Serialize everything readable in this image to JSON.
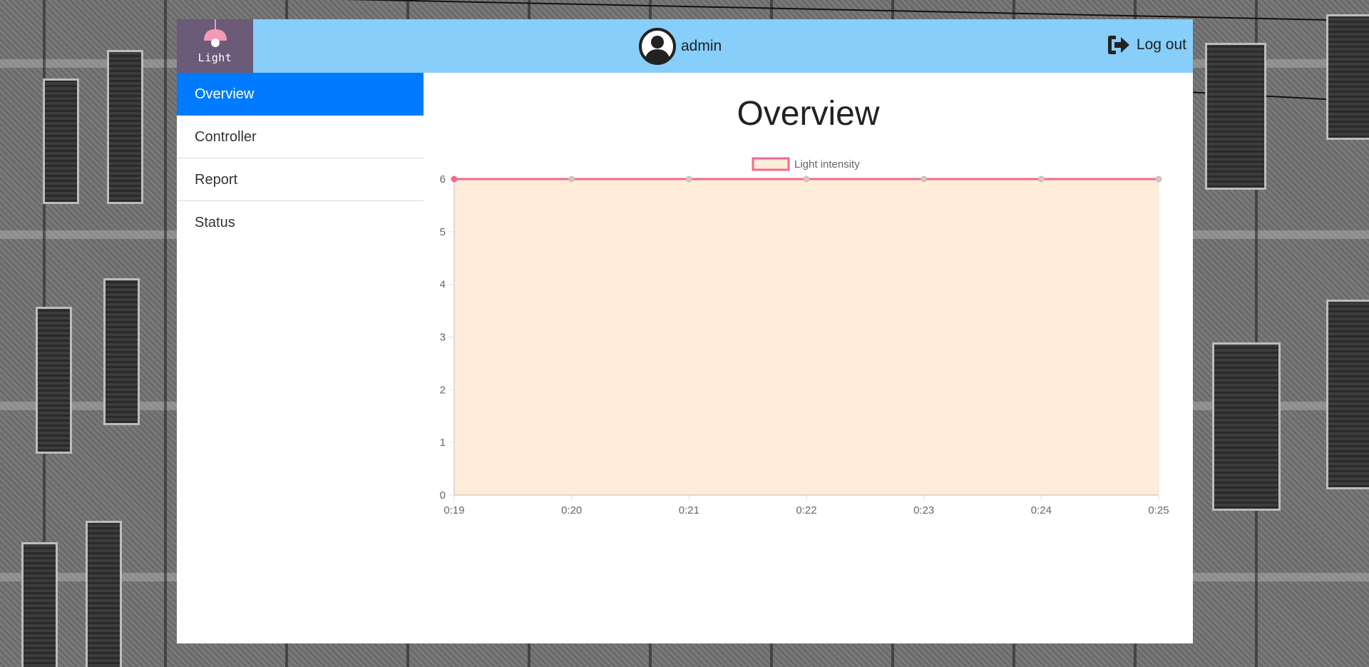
{
  "brand": {
    "label": "Light",
    "lamp_color": "#f39bb5",
    "background": "#6b5a78"
  },
  "header": {
    "background": "#87cefa",
    "user_icon": "user-circle-icon",
    "username": "admin",
    "logout_icon": "sign-out-icon",
    "logout_label": "Log out"
  },
  "sidebar": {
    "accent": "#007bff",
    "items": [
      {
        "label": "Overview",
        "active": true
      },
      {
        "label": "Controller",
        "active": false
      },
      {
        "label": "Report",
        "active": false
      },
      {
        "label": "Status",
        "active": false
      }
    ]
  },
  "main": {
    "title": "Overview"
  },
  "chart_data": {
    "type": "area",
    "x": [
      "0:19",
      "0:20",
      "0:21",
      "0:22",
      "0:23",
      "0:24",
      "0:25"
    ],
    "series": [
      {
        "name": "Light intensity",
        "values": [
          6,
          6,
          6,
          6,
          6,
          6,
          6
        ],
        "line_color": "#f06a8c",
        "fill_color": "#ffecd9"
      }
    ],
    "ylim": [
      0,
      6
    ],
    "yticks": [
      0,
      1,
      2,
      3,
      4,
      5,
      6
    ],
    "grid": true,
    "legend": "top-center",
    "title": "",
    "xlabel": "",
    "ylabel": ""
  }
}
